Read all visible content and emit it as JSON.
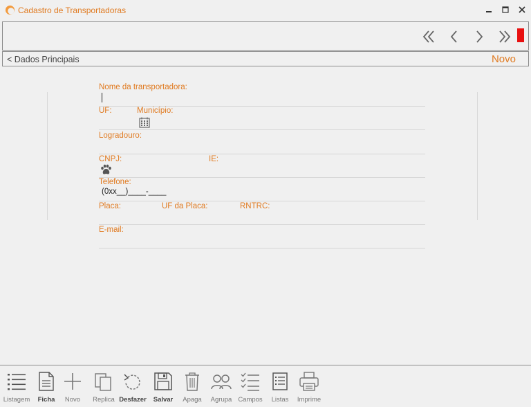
{
  "window": {
    "title": "Cadastro de Transportadoras"
  },
  "breadcrumb": {
    "label": "< Dados Principais",
    "mode": "Novo"
  },
  "form": {
    "nome_label": "Nome da transportadora:",
    "uf_label": "UF:",
    "municipio_label": "Município:",
    "logradouro_label": "Logradouro:",
    "cnpj_label": "CNPJ:",
    "ie_label": "IE:",
    "telefone_label": "Telefone:",
    "telefone_mask": "(0xx__)____-____",
    "placa_label": "Placa:",
    "uf_placa_label": "UF da Placa:",
    "rntrc_label": "RNTRC:",
    "email_label": "E-mail:"
  },
  "toolbar": {
    "items": [
      {
        "label": "Listagem",
        "icon": "list-icon",
        "bold": false
      },
      {
        "label": "Ficha",
        "icon": "document-icon",
        "bold": true
      },
      {
        "label": "Novo",
        "icon": "plus-icon",
        "bold": false
      },
      {
        "label": "Replica",
        "icon": "copy-icon",
        "bold": false
      },
      {
        "label": "Desfazer",
        "icon": "undo-icon",
        "bold": true
      },
      {
        "label": "Salvar",
        "icon": "floppy-icon",
        "bold": true
      },
      {
        "label": "Apaga",
        "icon": "trash-icon",
        "bold": false
      },
      {
        "label": "Agrupa",
        "icon": "group-icon",
        "bold": false
      },
      {
        "label": "Campos",
        "icon": "checklist-icon",
        "bold": false
      },
      {
        "label": "Listas",
        "icon": "lists-icon",
        "bold": false
      },
      {
        "label": "Imprime",
        "icon": "printer-icon",
        "bold": false
      }
    ]
  },
  "colors": {
    "accent": "#e07a20",
    "marker": "#e81010"
  }
}
